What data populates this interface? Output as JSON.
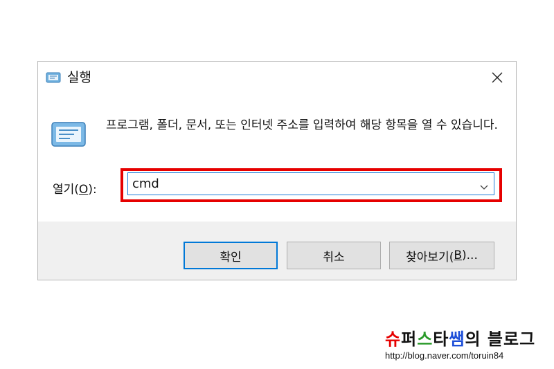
{
  "window": {
    "title": "실행",
    "icon": "run-icon",
    "close_icon": "close-icon"
  },
  "content": {
    "description": "프로그램, 폴더, 문서, 또는 인터넷 주소를 입력하여 해당 항목을 열 수 있습니다.",
    "open_label_prefix": "열기(",
    "open_label_accel": "O",
    "open_label_suffix": "):",
    "input_value": "cmd",
    "highlight_color": "#e60000"
  },
  "buttons": {
    "ok_label": "확인",
    "cancel_label": "취소",
    "browse_prefix": "찾아보기(",
    "browse_accel": "B",
    "browse_suffix": ")..."
  },
  "watermark": {
    "title_parts": [
      {
        "text": "슈",
        "color": "#e60000"
      },
      {
        "text": "퍼",
        "color": "#111111"
      },
      {
        "text": "스",
        "color": "#2a9a2a"
      },
      {
        "text": "타",
        "color": "#111111"
      },
      {
        "text": "쌤",
        "color": "#1e4fd8"
      },
      {
        "text": "의 블로그",
        "color": "#111111"
      }
    ],
    "url": "http://blog.naver.com/toruin84"
  }
}
